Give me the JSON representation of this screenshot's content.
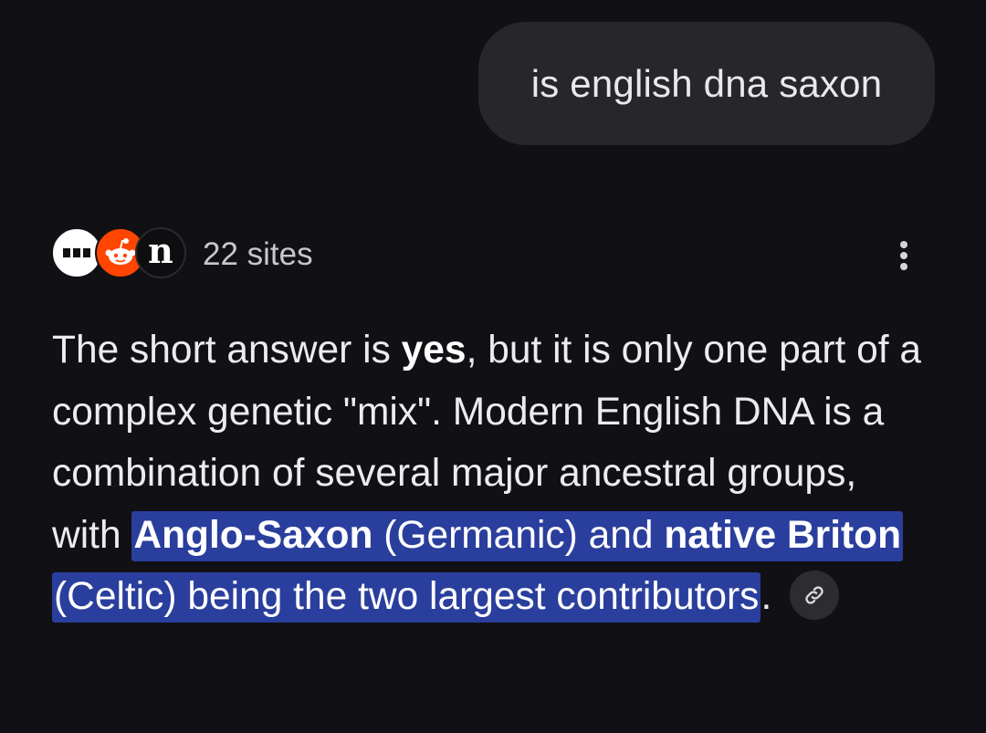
{
  "user_message": {
    "text": "is english dna saxon"
  },
  "sources": {
    "count_label": "22 sites",
    "favicons": [
      "dots-favicon-icon",
      "reddit-icon",
      "n-logo-icon"
    ],
    "favicon_letter": "n"
  },
  "answer": {
    "seg_1": "The short answer is ",
    "bold_1": "yes",
    "seg_2": ", but it is only one part of a complex genetic \"mix\". Modern English DNA is a combination of several major ancestral groups, with ",
    "hl_bold_1": "Anglo-Saxon",
    "hl_seg_1": " (Germanic) and ",
    "hl_bold_2": "native Briton",
    "hl_seg_2": " (Celtic) being the two largest contributors",
    "seg_3": ".",
    "link_icon": "link-icon"
  },
  "colors": {
    "background": "#111115",
    "bubble": "#26262b",
    "highlight": "#2a3e9d",
    "reddit": "#ff4500"
  }
}
